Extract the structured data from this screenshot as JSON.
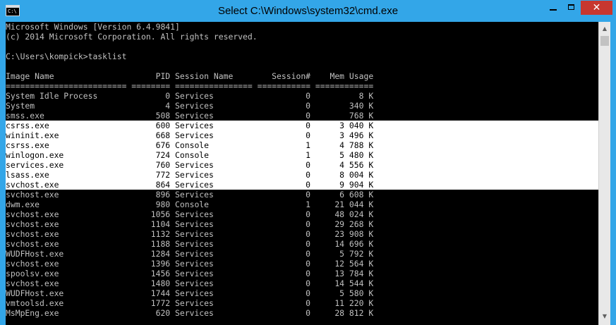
{
  "window": {
    "title": "Select C:\\Windows\\system32\\cmd.exe",
    "icon_label": "C:\\",
    "icon": "cmd-console-icon",
    "controls": {
      "minimize_icon": "minimize-icon",
      "maximize_icon": "maximize-icon",
      "close_glyph": "✕"
    },
    "colors": {
      "titlebar": "#33a6e8",
      "close": "#c7372f",
      "console_bg": "#000000",
      "console_fg": "#c0c0c0",
      "selection_bg": "#ffffff",
      "selection_fg": "#000000"
    }
  },
  "console": {
    "lines": [
      "Microsoft Windows [Version 6.4.9841]",
      "(c) 2014 Microsoft Corporation. All rights reserved.",
      "",
      "C:\\Users\\kompick>tasklist",
      "",
      "Image Name                     PID Session Name        Session#    Mem Usage",
      "========================= ======== ================ =========== ============",
      "System Idle Process              0 Services                   0          8 K",
      "System                           4 Services                   0        340 K",
      "smss.exe                       508 Services                   0        768 K",
      "csrss.exe                      600 Services                   0      3 040 K",
      "wininit.exe                    668 Services                   0      3 496 K",
      "csrss.exe                      676 Console                    1      4 788 K",
      "winlogon.exe                   724 Console                    1      5 480 K",
      "services.exe                   760 Services                   0      4 556 K",
      "lsass.exe                      772 Services                   0      8 004 K",
      "svchost.exe                    864 Services                   0      9 904 K",
      "svchost.exe                    896 Services                   0      6 608 K",
      "dwm.exe                        980 Console                    1     21 044 K",
      "svchost.exe                   1056 Services                   0     48 024 K",
      "svchost.exe                   1104 Services                   0     29 268 K",
      "svchost.exe                   1132 Services                   0     23 908 K",
      "svchost.exe                   1188 Services                   0     14 696 K",
      "WUDFHost.exe                  1284 Services                   0      5 792 K",
      "svchost.exe                   1396 Services                   0     12 564 K",
      "spoolsv.exe                   1456 Services                   0     13 784 K",
      "svchost.exe                   1480 Services                   0     14 544 K",
      "WUDFHost.exe                  1744 Services                   0      5 580 K",
      "vmtoolsd.exe                  1772 Services                   0     11 220 K",
      "MsMpEng.exe                    620 Services                   0     28 812 K"
    ],
    "selected_lines": [
      10,
      11,
      12,
      13,
      14,
      15,
      16
    ]
  },
  "scrollbar": {
    "up_glyph": "▲",
    "down_glyph": "▼",
    "position": 0.0
  }
}
